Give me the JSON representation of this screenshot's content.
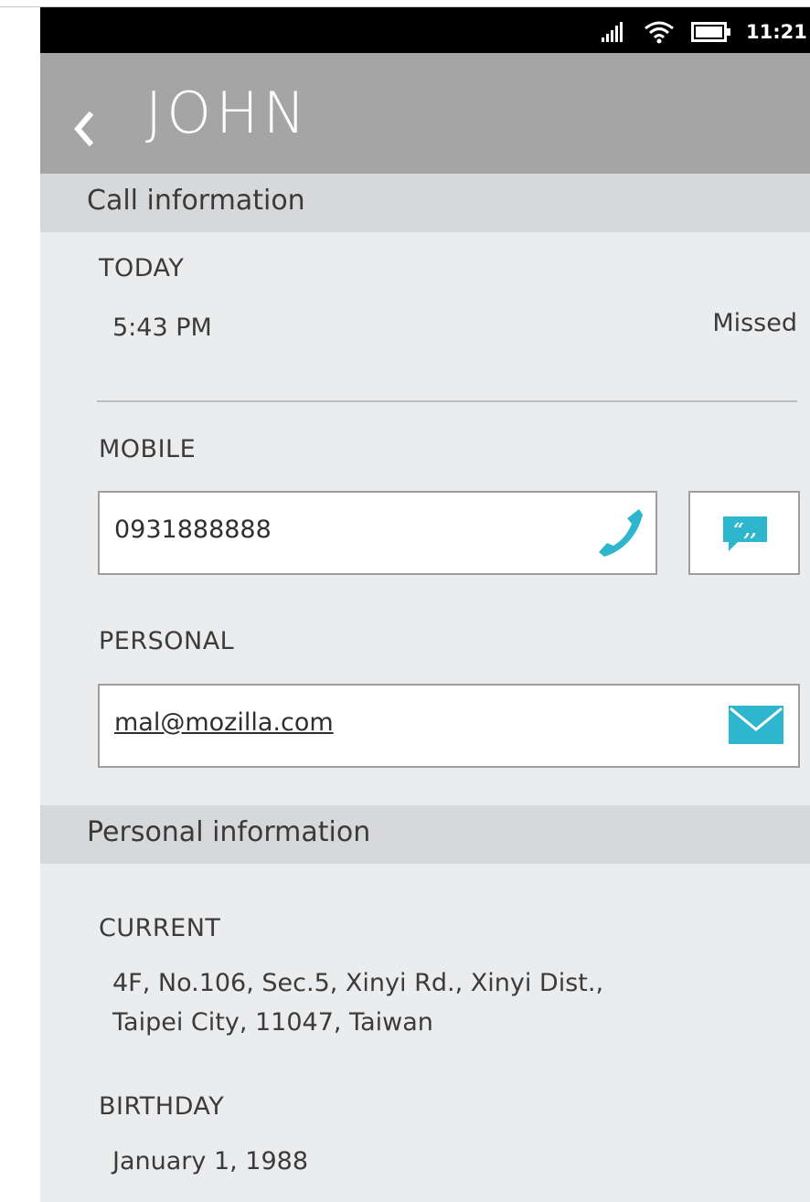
{
  "status_bar": {
    "time": "11:21 pm"
  },
  "header": {
    "title": "JOHN"
  },
  "call_information": {
    "section_title": "Call information",
    "day_label": "TODAY",
    "call_time": "5:43 PM",
    "call_status": "Missed"
  },
  "mobile": {
    "label": "MOBILE",
    "number": "0931888888"
  },
  "email": {
    "label": "PERSONAL",
    "address": "mal@mozilla.com"
  },
  "personal_information": {
    "section_title": "Personal information",
    "address_label": "CURRENT",
    "address_line1": "4F, No.106, Sec.5, Xinyi Rd., Xinyi Dist.,",
    "address_line2": "Taipei City, 11047, Taiwan",
    "birthday_label": "BIRTHDAY",
    "birthday": "January 1, 1988"
  },
  "colors": {
    "accent": "#2eb6cf",
    "header_bg": "#a5a5a5",
    "section_bg": "#d7d8da",
    "page_bg": "#ebecee"
  },
  "icons": {
    "back": "back-chevron-icon",
    "signal": "signal-icon",
    "wifi": "wifi-icon",
    "battery": "battery-icon",
    "call": "phone-icon",
    "message": "sms-icon",
    "email": "mail-icon"
  }
}
